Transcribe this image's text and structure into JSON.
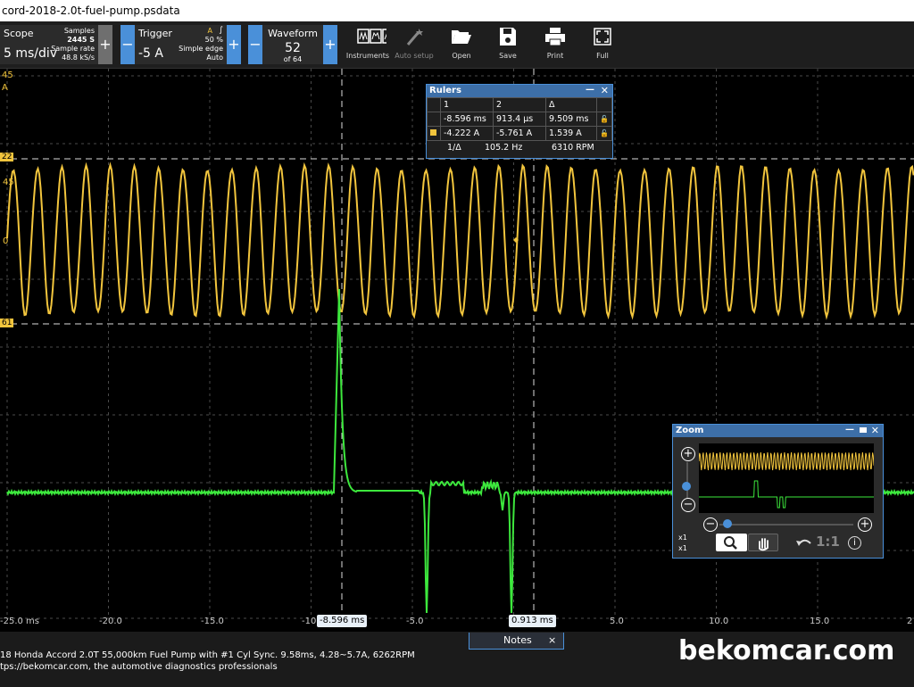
{
  "window": {
    "title": "cord-2018-2.0t-fuel-pump.psdata"
  },
  "toolbar": {
    "scope": {
      "label": "Scope",
      "value": "5 ms/div",
      "samples_label": "Samples",
      "samples_value": "2445 S",
      "rate_label": "Sample rate",
      "rate_value": "48.8 kS/s"
    },
    "trigger": {
      "label": "Trigger",
      "value": "-5 A",
      "channel": "A",
      "edge_symbol": "∫",
      "percent": "50 %",
      "type": "Simple edge",
      "mode": "Auto"
    },
    "waveform": {
      "label": "Waveform",
      "value": "52",
      "of": "of 64"
    },
    "buttons": {
      "instruments": "Instruments",
      "auto_setup": "Auto setup",
      "open": "Open",
      "save": "Save",
      "print": "Print",
      "full": "Full"
    },
    "minus": "−",
    "plus": "+"
  },
  "plot": {
    "left_axis": {
      "top_value": "45",
      "unit": "A",
      "upper_marker": "22",
      "mid_a": "45",
      "mid_b": "0",
      "lower_marker": "61"
    },
    "x_ticks": [
      "-25.0 ms",
      "-20.0",
      "-15.0",
      "-10",
      "-5.0",
      "0",
      "5.0",
      "10.0",
      "15.0",
      "2"
    ],
    "ruler_tag_1": "-8.596 ms",
    "ruler_tag_2": "0.913 ms",
    "colors": {
      "ch_a": "#f2c53d",
      "ch_b": "#3de83d",
      "grid": "#4a4a4a"
    }
  },
  "rulers": {
    "title": "Rulers",
    "head": [
      "1",
      "2",
      "Δ"
    ],
    "time_row": [
      "-8.596 ms",
      "913.4 µs",
      "9.509 ms"
    ],
    "amp_row": [
      "-4.222 A",
      "-5.761 A",
      "1.539 A"
    ],
    "freq_label": "1/Δ",
    "freq": "105.2 Hz",
    "rpm": "6310 RPM"
  },
  "zoom": {
    "title": "Zoom",
    "x1a": "x1",
    "x1b": "x1",
    "ratio": "1:1"
  },
  "notes": {
    "label": "Notes",
    "close": "×"
  },
  "status": {
    "line1": "18 Honda Accord 2.0T 55,000km Fuel Pump with #1 Cyl Sync. 9.58ms, 4.28~5.7A, 6262RPM",
    "line2": "tps://bekomcar.com, the automotive diagnostics professionals"
  },
  "brand": "bekomcar.com"
}
